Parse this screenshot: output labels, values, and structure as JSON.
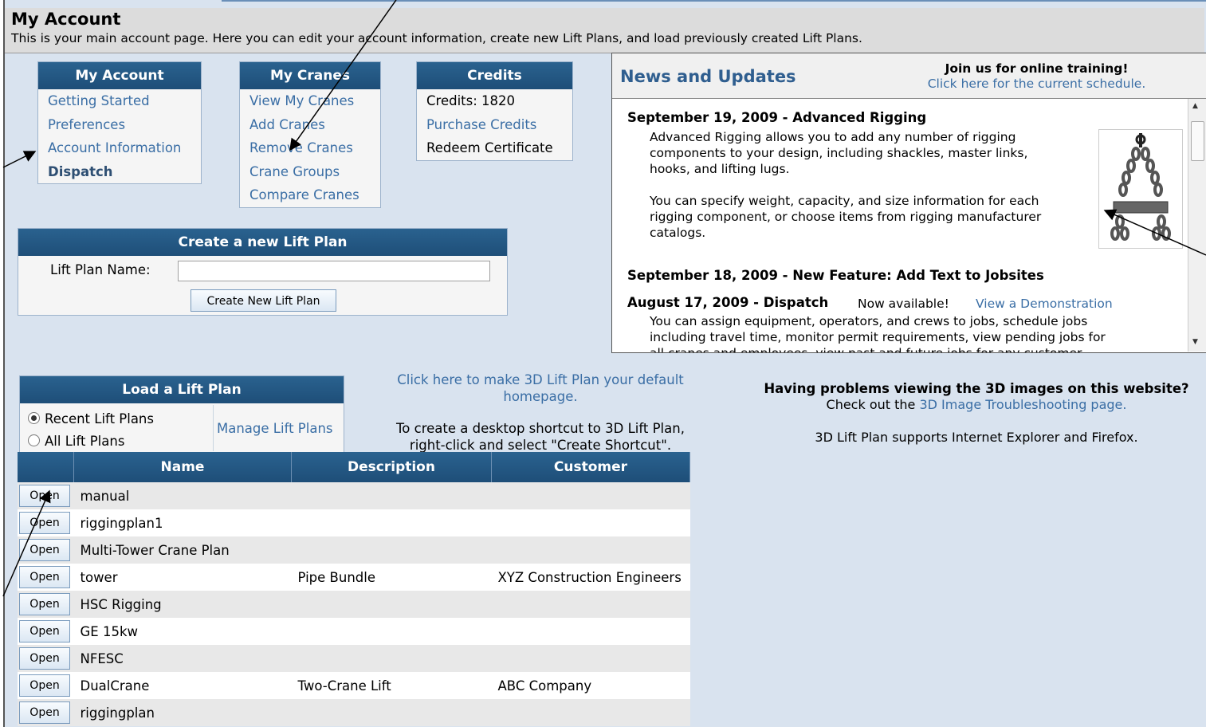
{
  "header": {
    "title": "My Account",
    "subtitle": "This is your main account page. Here you can edit your account information, create new Lift Plans, and load previously created Lift Plans."
  },
  "account_menu": {
    "title": "My Account",
    "items": [
      "Getting Started",
      "Preferences",
      "Account Information",
      "Dispatch"
    ]
  },
  "cranes_menu": {
    "title": "My Cranes",
    "items": [
      "View My Cranes",
      "Add Cranes",
      "Remove Cranes",
      "Crane Groups",
      "Compare Cranes"
    ]
  },
  "credits_menu": {
    "title": "Credits",
    "credits_text": "Credits: 1820",
    "purchase": "Purchase Credits",
    "redeem": "Redeem Certificate"
  },
  "create_plan": {
    "title": "Create a new Lift Plan",
    "name_label": "Lift Plan Name:",
    "name_value": "",
    "button": "Create New Lift Plan"
  },
  "news": {
    "title": "News and Updates",
    "join": "Join us for online training!",
    "join_link": "Click here for the current schedule.",
    "item1_title": "September 19, 2009 - Advanced Rigging",
    "item1_p1_l1": "Advanced Rigging allows you to add any number of rigging",
    "item1_p1_l2": "components to your design, including shackles, master links,",
    "item1_p1_l3": "hooks, and lifting lugs.",
    "item1_p2_l1": "You can specify weight, capacity, and size information for each",
    "item1_p2_l2": "rigging component, or choose items from rigging manufacturer",
    "item1_p2_l3": "catalogs.",
    "item2_title": "September 18, 2009 - New Feature: Add Text to Jobsites",
    "item3_title": "August 17, 2009 - Dispatch",
    "item3_available": "Now available!",
    "item3_link": "View a Demonstration",
    "item3_l1": "You can assign equipment, operators, and crews to jobs, schedule jobs",
    "item3_l2": "including travel time, monitor permit requirements, view pending jobs for",
    "item3_l3": "all cranes and employees, view past and future jobs for any customer,"
  },
  "homepage_link": {
    "line1": "Click here to make 3D Lift Plan your default",
    "line2": "homepage."
  },
  "shortcut": {
    "line1": "To create a desktop shortcut to 3D Lift Plan,",
    "line2": "right-click and select \"Create Shortcut\"."
  },
  "troubleshoot": {
    "question": "Having problems viewing the 3D images on this website?",
    "prefix": "Check out the",
    "link": "3D Image Troubleshooting page.",
    "browsers": "3D Lift Plan supports Internet Explorer and Firefox."
  },
  "load_plan": {
    "title": "Load a Lift Plan",
    "recent": "Recent Lift Plans",
    "all": "All Lift Plans",
    "selected": "Recent Lift Plans",
    "manage": "Manage Lift Plans"
  },
  "table": {
    "headers": [
      "Name",
      "Description",
      "Customer"
    ],
    "open_label": "Open",
    "rows": [
      {
        "name": "manual",
        "description": "",
        "customer": ""
      },
      {
        "name": "riggingplan1",
        "description": "",
        "customer": ""
      },
      {
        "name": "Multi-Tower Crane Plan",
        "description": "",
        "customer": ""
      },
      {
        "name": "tower",
        "description": "Pipe Bundle",
        "customer": "XYZ Construction Engineers"
      },
      {
        "name": "HSC Rigging",
        "description": "",
        "customer": ""
      },
      {
        "name": "GE 15kw",
        "description": "",
        "customer": ""
      },
      {
        "name": "NFESC",
        "description": "",
        "customer": ""
      },
      {
        "name": "DualCrane",
        "description": "Two-Crane Lift",
        "customer": "ABC Company"
      },
      {
        "name": "riggingplan",
        "description": "",
        "customer": ""
      }
    ]
  },
  "colors": {
    "header_blue": "#1e4e78",
    "link_blue": "#3a6ea5",
    "background": "#d9e3ef"
  }
}
